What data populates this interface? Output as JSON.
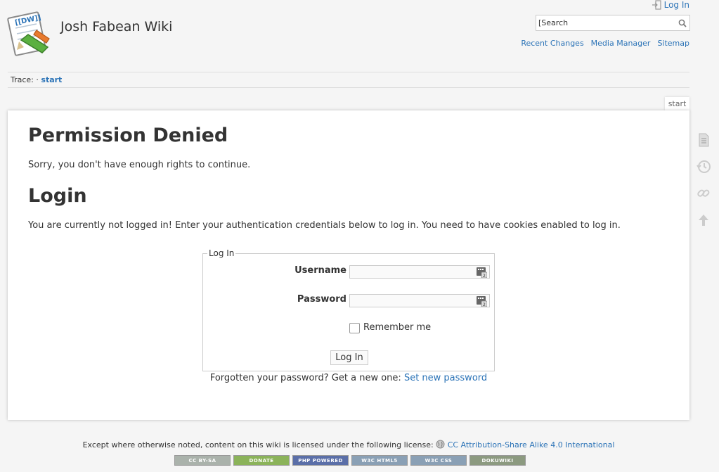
{
  "header": {
    "site_title": "Josh Fabean Wiki",
    "logo_text": "[[DW]]",
    "login_label": "Log In",
    "search_placeholder": "Search",
    "search_value": "[Search",
    "nav": [
      "Recent Changes",
      "Media Manager",
      "Sitemap"
    ]
  },
  "breadcrumb": {
    "label": "Trace:",
    "sep": "·",
    "crumb": "start"
  },
  "page_tag": "start",
  "content": {
    "heading1": "Permission Denied",
    "para1": "Sorry, you don't have enough rights to continue.",
    "heading2": "Login",
    "para2": "You are currently not logged in! Enter your authentication credentials below to log in. You need to have cookies enabled to log in."
  },
  "login_form": {
    "legend": "Log In",
    "username_label": "Username",
    "username_value": "",
    "password_label": "Password",
    "password_value": "",
    "remember_label": "Remember me",
    "remember_checked": false,
    "submit_label": "Log In",
    "forgot_text": "Forgotten your password? Get a new one:",
    "forgot_link": "Set new password"
  },
  "toolbar": [
    "page-icon",
    "history-icon",
    "backlinks-icon",
    "back-to-top-icon"
  ],
  "footer": {
    "license_text": "Except where otherwise noted, content on this wiki is licensed under the following license:",
    "license_link": "CC Attribution-Share Alike 4.0 International",
    "badges": [
      {
        "label": "CC BY-SA",
        "color": "#aab2ab"
      },
      {
        "label": "DONATE",
        "color": "#8bb35a"
      },
      {
        "label": "PHP POWERED",
        "color": "#5b6fa8"
      },
      {
        "label": "W3C HTML5",
        "color": "#8aa0b5"
      },
      {
        "label": "W3C CSS",
        "color": "#8aa0b5"
      },
      {
        "label": "DOKUWIKI",
        "color": "#8c9a80"
      }
    ]
  },
  "colors": {
    "link": "#2b73b7",
    "background": "#f5f5f5",
    "text": "#333333"
  }
}
